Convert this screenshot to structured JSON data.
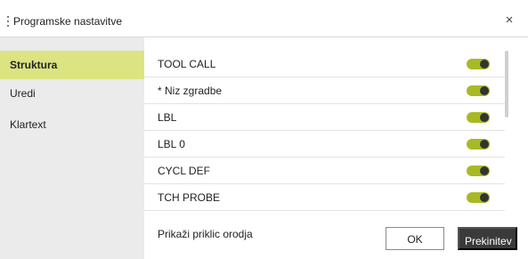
{
  "dialog": {
    "title": "Programske nastavitve",
    "close_symbol": "×"
  },
  "sidebar": {
    "items": [
      {
        "label": "Struktura",
        "active": true
      },
      {
        "label": "Uredi",
        "active": false
      },
      {
        "label": "Klartext",
        "active": false
      }
    ]
  },
  "settings": {
    "rows": [
      {
        "label": "TOOL CALL",
        "enabled": true
      },
      {
        "label": "* Niz zgradbe",
        "enabled": true
      },
      {
        "label": "LBL",
        "enabled": true
      },
      {
        "label": "LBL 0",
        "enabled": true
      },
      {
        "label": "CYCL DEF",
        "enabled": true
      },
      {
        "label": "TCH PROBE",
        "enabled": true
      }
    ]
  },
  "footer": {
    "label": "Prikaži priklic orodja",
    "ok_label": "OK",
    "cancel_label": "Prekinitev"
  },
  "colors": {
    "accent": "#dbe481",
    "toggle_on": "#a9b925",
    "sidebar_bg": "#ebebeb",
    "cancel_bg": "#3a3a3a"
  }
}
